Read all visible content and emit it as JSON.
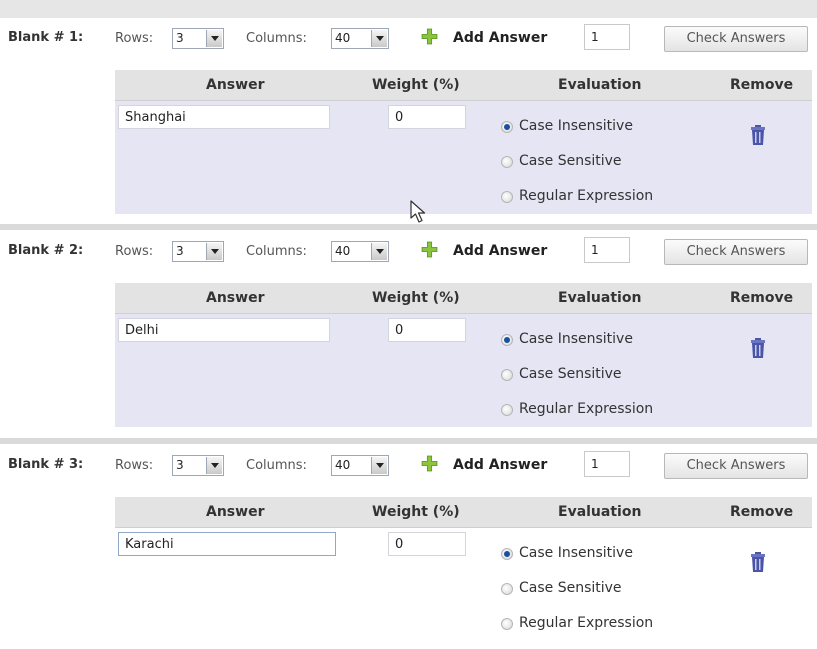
{
  "blanks": [
    {
      "label": "Blank # 1:",
      "rows_label": "Rows:",
      "rows_value": "3",
      "columns_label": "Columns:",
      "columns_value": "40",
      "add_answer_label": "Add Answer",
      "add_answer_count": "1",
      "check_label": "Check Answers",
      "headers": {
        "answer": "Answer",
        "weight": "Weight (%)",
        "evaluation": "Evaluation",
        "remove": "Remove"
      },
      "answer_value": "Shanghai",
      "weight_value": "0",
      "options": [
        "Case Insensitive",
        "Case Sensitive",
        "Regular Expression"
      ],
      "selected_option": "Case Insensitive"
    },
    {
      "label": "Blank # 2:",
      "rows_label": "Rows:",
      "rows_value": "3",
      "columns_label": "Columns:",
      "columns_value": "40",
      "add_answer_label": "Add Answer",
      "add_answer_count": "1",
      "check_label": "Check Answers",
      "headers": {
        "answer": "Answer",
        "weight": "Weight (%)",
        "evaluation": "Evaluation",
        "remove": "Remove"
      },
      "answer_value": "Delhi",
      "weight_value": "0",
      "options": [
        "Case Insensitive",
        "Case Sensitive",
        "Regular Expression"
      ],
      "selected_option": "Case Insensitive"
    },
    {
      "label": "Blank # 3:",
      "rows_label": "Rows:",
      "rows_value": "3",
      "columns_label": "Columns:",
      "columns_value": "40",
      "add_answer_label": "Add Answer",
      "add_answer_count": "1",
      "check_label": "Check Answers",
      "headers": {
        "answer": "Answer",
        "weight": "Weight (%)",
        "evaluation": "Evaluation",
        "remove": "Remove"
      },
      "answer_value": "Karachi",
      "weight_value": "0",
      "options": [
        "Case Insensitive",
        "Case Sensitive",
        "Regular Expression"
      ],
      "selected_option": "Case Insensitive"
    }
  ],
  "icons": {
    "add": "plus-icon",
    "remove": "trash-icon",
    "cursor": "mouse-pointer-icon"
  },
  "colors": {
    "panel": "#e5e5f4",
    "header": "#e3e3e3",
    "add_icon": "#8bc43f",
    "trash_icon": "#4a55a8"
  }
}
